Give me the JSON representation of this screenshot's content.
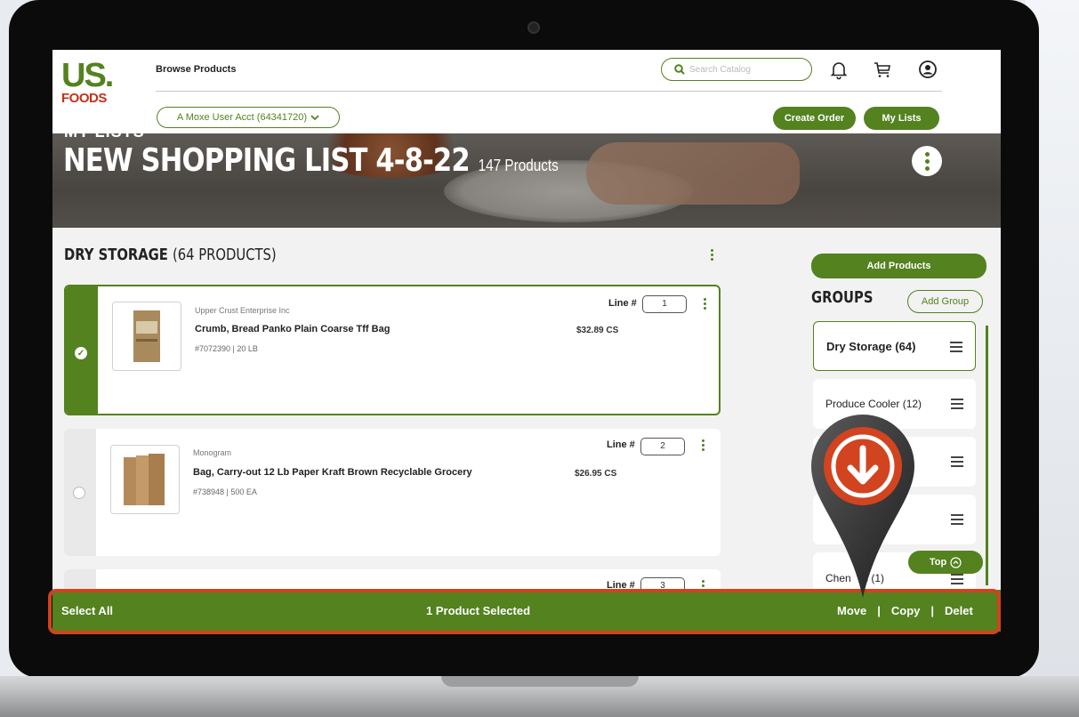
{
  "header": {
    "logo_us": "US.",
    "logo_foods": "FOODS",
    "browse": "Browse Products",
    "search_placeholder": "Search Catalog",
    "account": "A Moxe User Acct (64341720)",
    "create_order": "Create Order",
    "my_lists": "My Lists"
  },
  "hero": {
    "breadcrumb": "MY LISTS",
    "title": "NEW SHOPPING LIST 4-8-22",
    "count": "147 Products"
  },
  "section": {
    "name": "DRY STORAGE",
    "count": "(64 PRODUCTS)"
  },
  "products": [
    {
      "brand": "Upper Crust Enterprise Inc",
      "name": "Crumb, Bread Panko Plain Coarse Tff Bag",
      "meta": "#7072390  |  20 LB",
      "price": "$32.89 CS",
      "line_label": "Line #",
      "line": "1",
      "selected": true
    },
    {
      "brand": "Monogram",
      "name": "Bag, Carry-out 12 Lb Paper Kraft Brown Recyclable Grocery",
      "meta": "#738948  |  500 EA",
      "price": "$26.95 CS",
      "line_label": "Line #",
      "line": "2",
      "selected": false
    },
    {
      "line_label": "Line #",
      "line": "3"
    }
  ],
  "side": {
    "add_products": "Add Products",
    "groups_title": "GROUPS",
    "add_group": "Add Group",
    "groups": [
      "Dry Storage (64)",
      "Produce Cooler (12)",
      "",
      "",
      "Chen    s (1)"
    ],
    "top": "Top"
  },
  "bottom_bar": {
    "select_all": "Select All",
    "selected": "1 Product Selected",
    "move": "Move",
    "copy": "Copy",
    "delete": "Delet",
    "sep": "|"
  },
  "colors": {
    "brand_green": "#53821f",
    "highlight": "#d1421f"
  }
}
